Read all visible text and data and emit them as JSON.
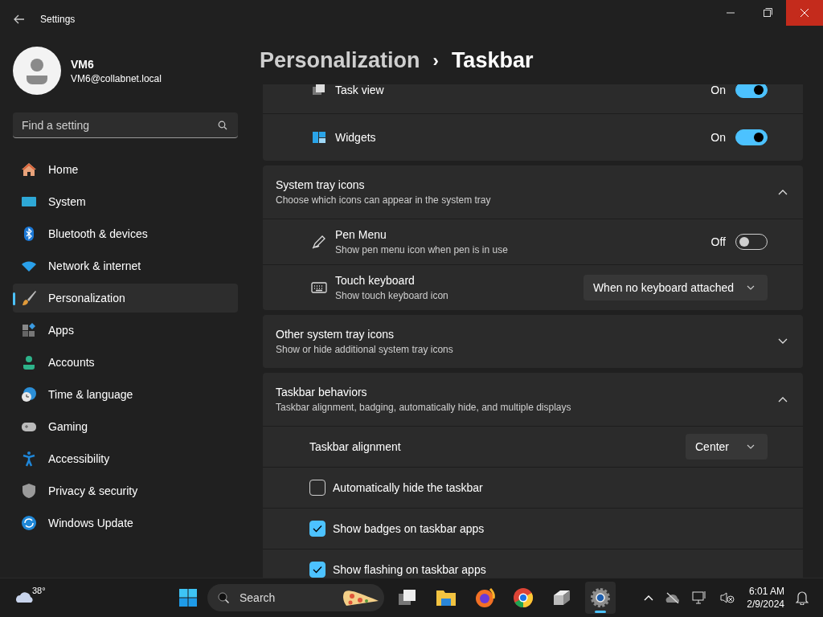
{
  "window": {
    "title": "Settings"
  },
  "user": {
    "name": "VM6",
    "email": "VM6@collabnet.local"
  },
  "search": {
    "placeholder": "Find a setting"
  },
  "nav": [
    {
      "label": "Home",
      "kind": "home",
      "selected": false
    },
    {
      "label": "System",
      "kind": "system",
      "selected": false
    },
    {
      "label": "Bluetooth & devices",
      "kind": "bluetooth",
      "selected": false
    },
    {
      "label": "Network & internet",
      "kind": "network",
      "selected": false
    },
    {
      "label": "Personalization",
      "kind": "brush",
      "selected": true
    },
    {
      "label": "Apps",
      "kind": "apps",
      "selected": false
    },
    {
      "label": "Accounts",
      "kind": "accounts",
      "selected": false
    },
    {
      "label": "Time & language",
      "kind": "time",
      "selected": false
    },
    {
      "label": "Gaming",
      "kind": "gaming",
      "selected": false
    },
    {
      "label": "Accessibility",
      "kind": "accessibility",
      "selected": false
    },
    {
      "label": "Privacy & security",
      "kind": "privacy",
      "selected": false
    },
    {
      "label": "Windows Update",
      "kind": "update",
      "selected": false
    }
  ],
  "breadcrumb": {
    "parent": "Personalization",
    "separator": "›",
    "current": "Taskbar"
  },
  "sections": [
    {
      "rows": [
        {
          "kind": "toggle",
          "label": "Task view",
          "state_label": "On",
          "on": true
        },
        {
          "kind": "toggle",
          "label": "Widgets",
          "state_label": "On",
          "on": true
        }
      ]
    },
    {
      "title": "System tray icons",
      "subtitle": "Choose which icons can appear in the system tray",
      "expanded": true,
      "rows": [
        {
          "kind": "toggle",
          "label": "Pen Menu",
          "description": "Show pen menu icon when pen is in use",
          "state_label": "Off",
          "on": false
        },
        {
          "kind": "dropdown",
          "label": "Touch keyboard",
          "description": "Show touch keyboard icon",
          "value": "When no keyboard attached"
        }
      ]
    },
    {
      "title": "Other system tray icons",
      "subtitle": "Show or hide additional system tray icons",
      "expanded": false
    },
    {
      "title": "Taskbar behaviors",
      "subtitle": "Taskbar alignment, badging, automatically hide, and multiple displays",
      "expanded": true,
      "rows": [
        {
          "kind": "dropdown",
          "label": "Taskbar alignment",
          "value": "Center"
        },
        {
          "kind": "checkbox",
          "label": "Automatically hide the taskbar",
          "checked": false
        },
        {
          "kind": "checkbox",
          "label": "Show badges on taskbar apps",
          "checked": true
        },
        {
          "kind": "checkbox",
          "label": "Show flashing on taskbar apps",
          "checked": true
        }
      ]
    }
  ],
  "taskbar": {
    "temperature": "38°",
    "search_placeholder": "Search",
    "apps": [
      {
        "kind": "taskview",
        "active": false
      },
      {
        "kind": "folder",
        "active": false
      },
      {
        "kind": "firefox",
        "active": false
      },
      {
        "kind": "chrome",
        "active": false
      },
      {
        "kind": "drive",
        "active": false
      },
      {
        "kind": "settings",
        "active": true
      }
    ],
    "time": "6:01 AM",
    "date": "2/9/2024"
  }
}
